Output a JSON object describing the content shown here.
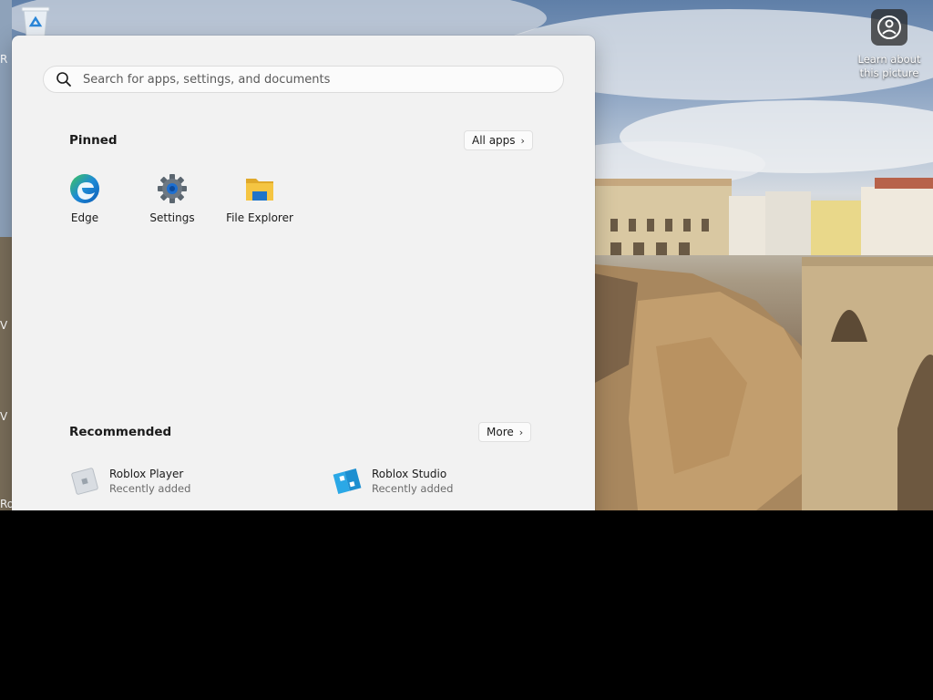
{
  "desktop": {
    "learn_label_line1": "Learn about",
    "learn_label_line2": "this picture",
    "side_fragments": [
      "R",
      "V",
      "V",
      "Ro"
    ]
  },
  "start_menu": {
    "search": {
      "placeholder": "Search for apps, settings, and documents",
      "value": ""
    },
    "pinned": {
      "title": "Pinned",
      "all_apps_label": "All apps",
      "apps": [
        {
          "label": "Edge",
          "icon": "edge-icon"
        },
        {
          "label": "Settings",
          "icon": "gear-icon"
        },
        {
          "label": "File Explorer",
          "icon": "folder-icon"
        }
      ]
    },
    "recommended": {
      "title": "Recommended",
      "more_label": "More",
      "items": [
        {
          "name": "Roblox Player",
          "sub": "Recently added",
          "icon": "roblox-player-icon"
        },
        {
          "name": "Roblox Studio",
          "sub": "Recently added",
          "icon": "roblox-studio-icon"
        }
      ]
    }
  },
  "colors": {
    "menu_bg": "#f2f2f2",
    "edge_blue": "#1e8ad6",
    "edge_green": "#3ec65a",
    "folder_yellow": "#f5c542",
    "roblox_studio_blue": "#2ba8e6"
  }
}
